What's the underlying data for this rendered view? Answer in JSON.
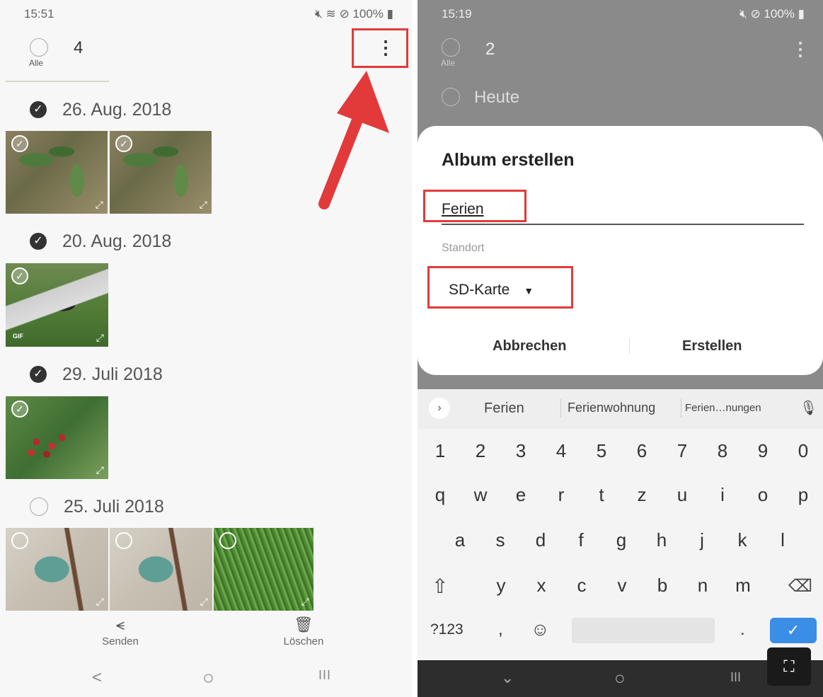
{
  "left": {
    "status": {
      "time": "15:51",
      "right": "100%"
    },
    "header": {
      "count": "4",
      "all_label": "Alle"
    },
    "groups": [
      {
        "date": "26. Aug. 2018",
        "selected": true
      },
      {
        "date": "20. Aug. 2018",
        "selected": true
      },
      {
        "date": "29. Juli 2018",
        "selected": true
      },
      {
        "date": "25. Juli 2018",
        "selected": false
      }
    ],
    "gif_badge": "GIF",
    "bottom": {
      "share_label": "Senden",
      "delete_label": "Löschen"
    },
    "nav": {
      "back": "<",
      "home": "○",
      "recents": "III"
    }
  },
  "right": {
    "status": {
      "time": "15:19",
      "right": "100%"
    },
    "header": {
      "count": "2",
      "all_label": "Alle",
      "today_label": "Heute"
    },
    "dialog": {
      "title": "Album erstellen",
      "name_value": "Ferien",
      "location_label": "Standort",
      "location_value": "SD-Karte",
      "cancel_label": "Abbrechen",
      "create_label": "Erstellen"
    },
    "keyboard": {
      "suggestions": [
        "Ferien",
        "Ferienwohnung",
        "Ferien…nungen"
      ],
      "row_numbers": [
        "1",
        "2",
        "3",
        "4",
        "5",
        "6",
        "7",
        "8",
        "9",
        "0"
      ],
      "row_1": [
        "q",
        "w",
        "e",
        "r",
        "t",
        "z",
        "u",
        "i",
        "o",
        "p"
      ],
      "row_2": [
        "a",
        "s",
        "d",
        "f",
        "g",
        "h",
        "j",
        "k",
        "l"
      ],
      "row_3": [
        "y",
        "x",
        "c",
        "v",
        "b",
        "n",
        "m"
      ],
      "symbols_label": "?123",
      "comma": ",",
      "period": "."
    },
    "nav": {
      "back": "⌄",
      "home": "○",
      "recents": "III"
    }
  },
  "colors": {
    "annotation_red": "#e23a3a",
    "confirm_blue": "#3a8ee6"
  }
}
